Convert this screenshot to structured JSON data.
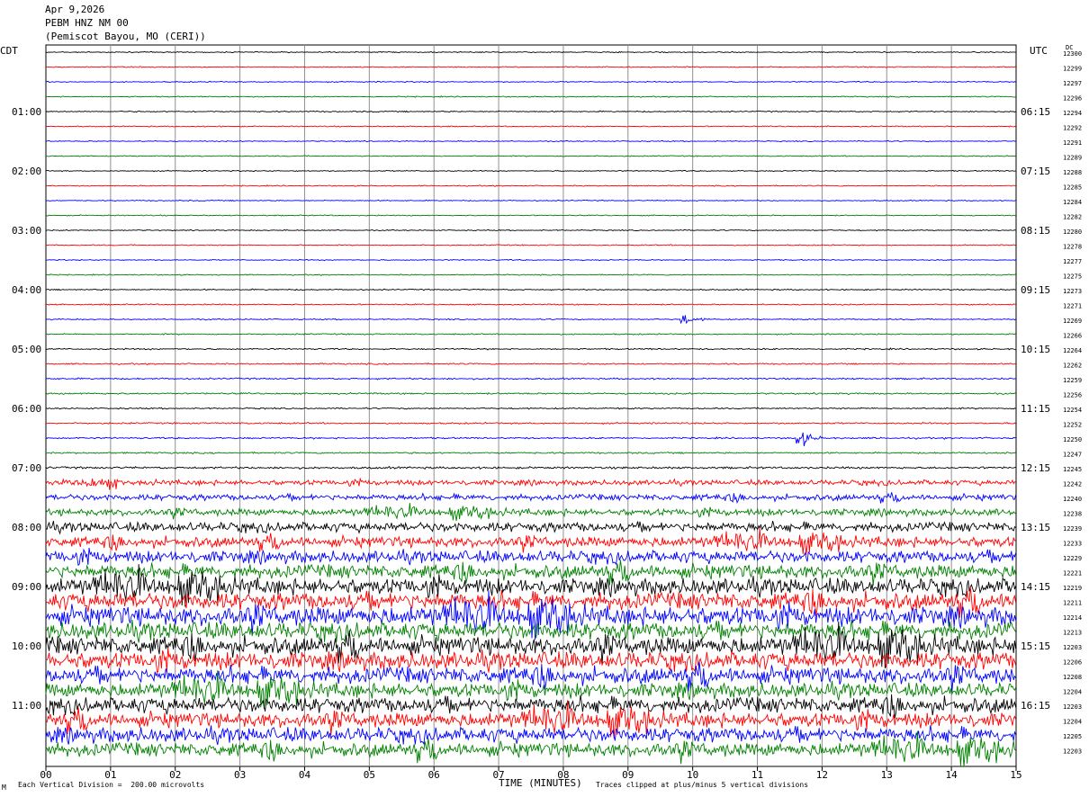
{
  "header": {
    "date": "Apr 9,2026",
    "station": "PEBM HNZ NM 00",
    "location": "(Pemiscot Bayou, MO (CERI))"
  },
  "left_timezone": "CDT",
  "right_timezone": "UTC",
  "dc_label": "DC",
  "footer": {
    "xlabel": "TIME (MINUTES)",
    "scale_note": "Each Vertical Division =  200.00 microvolts",
    "clip_note": "Traces clipped at plus/minus 5 vertical divisions",
    "corner_mark": "M"
  },
  "chart_data": {
    "type": "line",
    "x_ticks": [
      "00",
      "01",
      "02",
      "03",
      "04",
      "05",
      "06",
      "07",
      "08",
      "09",
      "10",
      "11",
      "12",
      "13",
      "14",
      "15"
    ],
    "xlim": [
      0,
      15
    ],
    "grid": true,
    "trace_colors": [
      "#000000",
      "#ff0000",
      "#0000ff",
      "#008000"
    ],
    "left_time_labels": [
      {
        "trace": 4,
        "label": "01:00"
      },
      {
        "trace": 8,
        "label": "02:00"
      },
      {
        "trace": 12,
        "label": "03:00"
      },
      {
        "trace": 16,
        "label": "04:00"
      },
      {
        "trace": 20,
        "label": "05:00"
      },
      {
        "trace": 24,
        "label": "06:00"
      },
      {
        "trace": 28,
        "label": "07:00"
      },
      {
        "trace": 32,
        "label": "08:00"
      },
      {
        "trace": 36,
        "label": "09:00"
      },
      {
        "trace": 40,
        "label": "10:00"
      },
      {
        "trace": 44,
        "label": "11:00"
      }
    ],
    "right_time_labels": [
      {
        "trace": 4,
        "label": "06:15"
      },
      {
        "trace": 8,
        "label": "07:15"
      },
      {
        "trace": 12,
        "label": "08:15"
      },
      {
        "trace": 16,
        "label": "09:15"
      },
      {
        "trace": 20,
        "label": "10:15"
      },
      {
        "trace": 24,
        "label": "11:15"
      },
      {
        "trace": 28,
        "label": "12:15"
      },
      {
        "trace": 32,
        "label": "13:15"
      },
      {
        "trace": 36,
        "label": "14:15"
      },
      {
        "trace": 40,
        "label": "15:15"
      },
      {
        "trace": 44,
        "label": "16:15"
      }
    ],
    "dc_offsets": [
      "12300",
      "12299",
      "12297",
      "12296",
      "12294",
      "12292",
      "12291",
      "12289",
      "12288",
      "12285",
      "12284",
      "12282",
      "12280",
      "12278",
      "12277",
      "12275",
      "12273",
      "12271",
      "12269",
      "12266",
      "12264",
      "12262",
      "12259",
      "12256",
      "12254",
      "12252",
      "12250",
      "12247",
      "12245",
      "12242",
      "12240",
      "12238",
      "12239",
      "12233",
      "12229",
      "12221",
      "12219",
      "12211",
      "12214",
      "12213",
      "12203",
      "12206",
      "12208",
      "12204",
      "12203",
      "12204",
      "12205",
      "12203"
    ],
    "trace_noise_levels": [
      0.06,
      0.06,
      0.06,
      0.06,
      0.07,
      0.06,
      0.06,
      0.06,
      0.06,
      0.06,
      0.06,
      0.06,
      0.06,
      0.06,
      0.06,
      0.06,
      0.07,
      0.07,
      0.07,
      0.07,
      0.08,
      0.08,
      0.09,
      0.09,
      0.08,
      0.09,
      0.09,
      0.09,
      0.12,
      0.3,
      0.35,
      0.4,
      0.55,
      0.6,
      0.7,
      0.8,
      0.95,
      1.0,
      1.1,
      1.0,
      1.05,
      1.0,
      0.95,
      0.85,
      0.9,
      0.85,
      0.85,
      0.8
    ],
    "events": [
      {
        "trace": 18,
        "minute": 9.85,
        "amplitude": 0.5
      },
      {
        "trace": 26,
        "minute": 11.65,
        "amplitude": 0.9
      }
    ]
  }
}
